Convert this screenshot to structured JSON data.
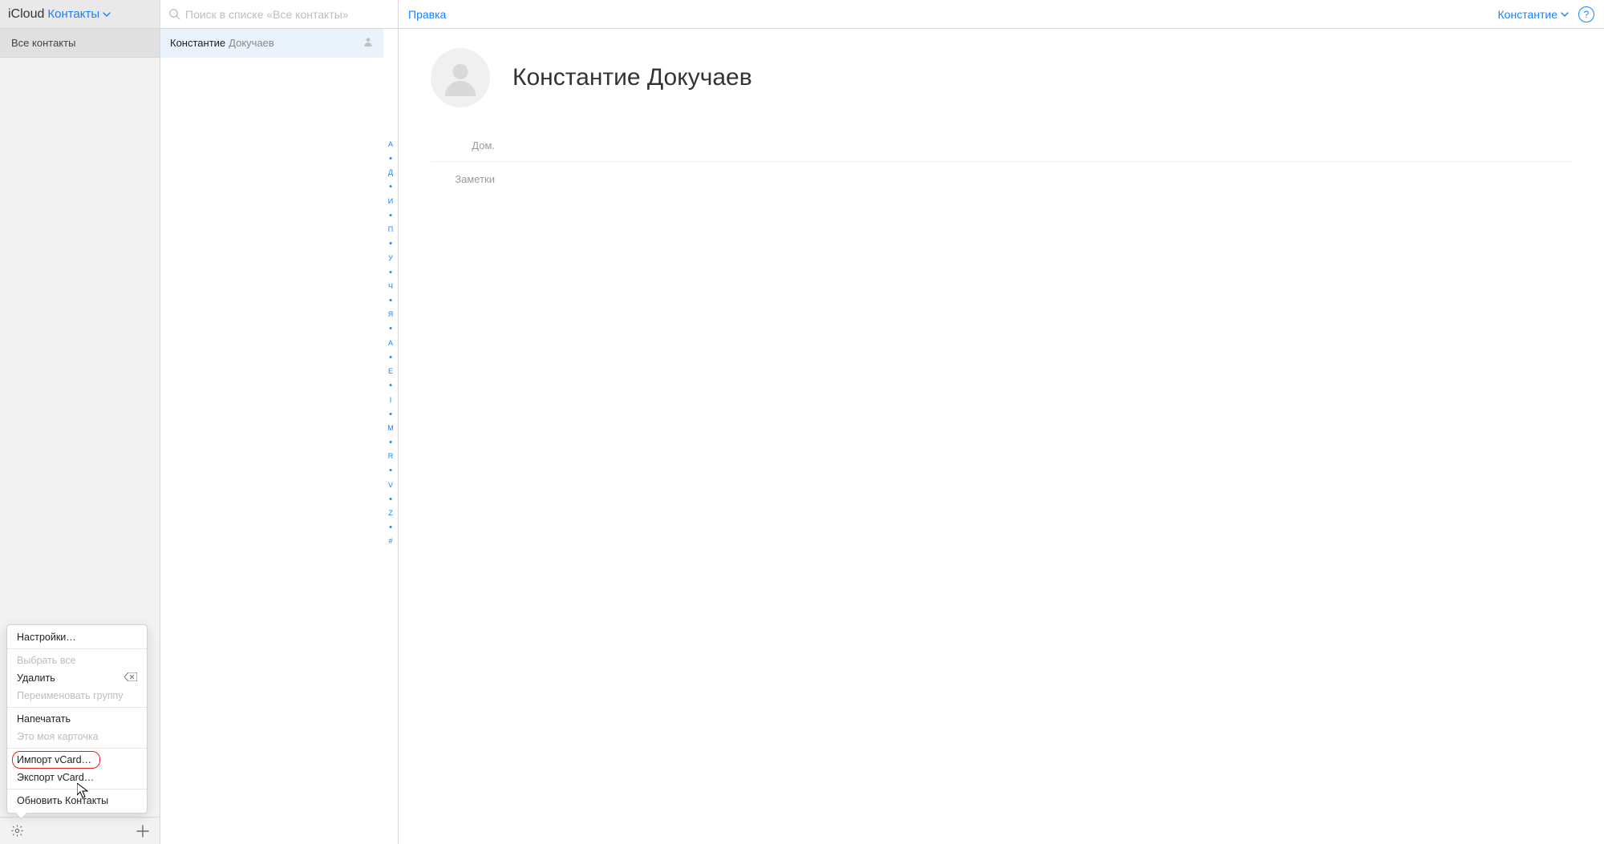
{
  "topbar": {
    "brand": "iCloud",
    "app_label": "Контакты",
    "search_placeholder": "Поиск в списке «Все контакты»",
    "edit_label": "Правка",
    "me_label": "Константие",
    "help_label": "?"
  },
  "groups": {
    "all_contacts": "Все контакты"
  },
  "list": {
    "selected": {
      "first": "Константие",
      "last": "Докучаев"
    }
  },
  "alpha_index": [
    "А",
    "•",
    "Д",
    "•",
    "И",
    "•",
    "П",
    "•",
    "У",
    "•",
    "Ч",
    "•",
    "Я",
    "•",
    "A",
    "•",
    "E",
    "•",
    "I",
    "•",
    "M",
    "•",
    "R",
    "•",
    "V",
    "•",
    "Z",
    "•",
    "#"
  ],
  "detail": {
    "name": "Константие Докучаев",
    "home_label": "Дом.",
    "notes_label": "Заметки"
  },
  "menu": {
    "settings": "Настройки…",
    "select_all": "Выбрать все",
    "delete": "Удалить",
    "rename_group": "Переименовать группу",
    "print": "Напечатать",
    "my_card": "Это моя карточка",
    "import_vcard": "Импорт vCard…",
    "export_vcard": "Экспорт vCard…",
    "refresh": "Обновить Контакты"
  }
}
